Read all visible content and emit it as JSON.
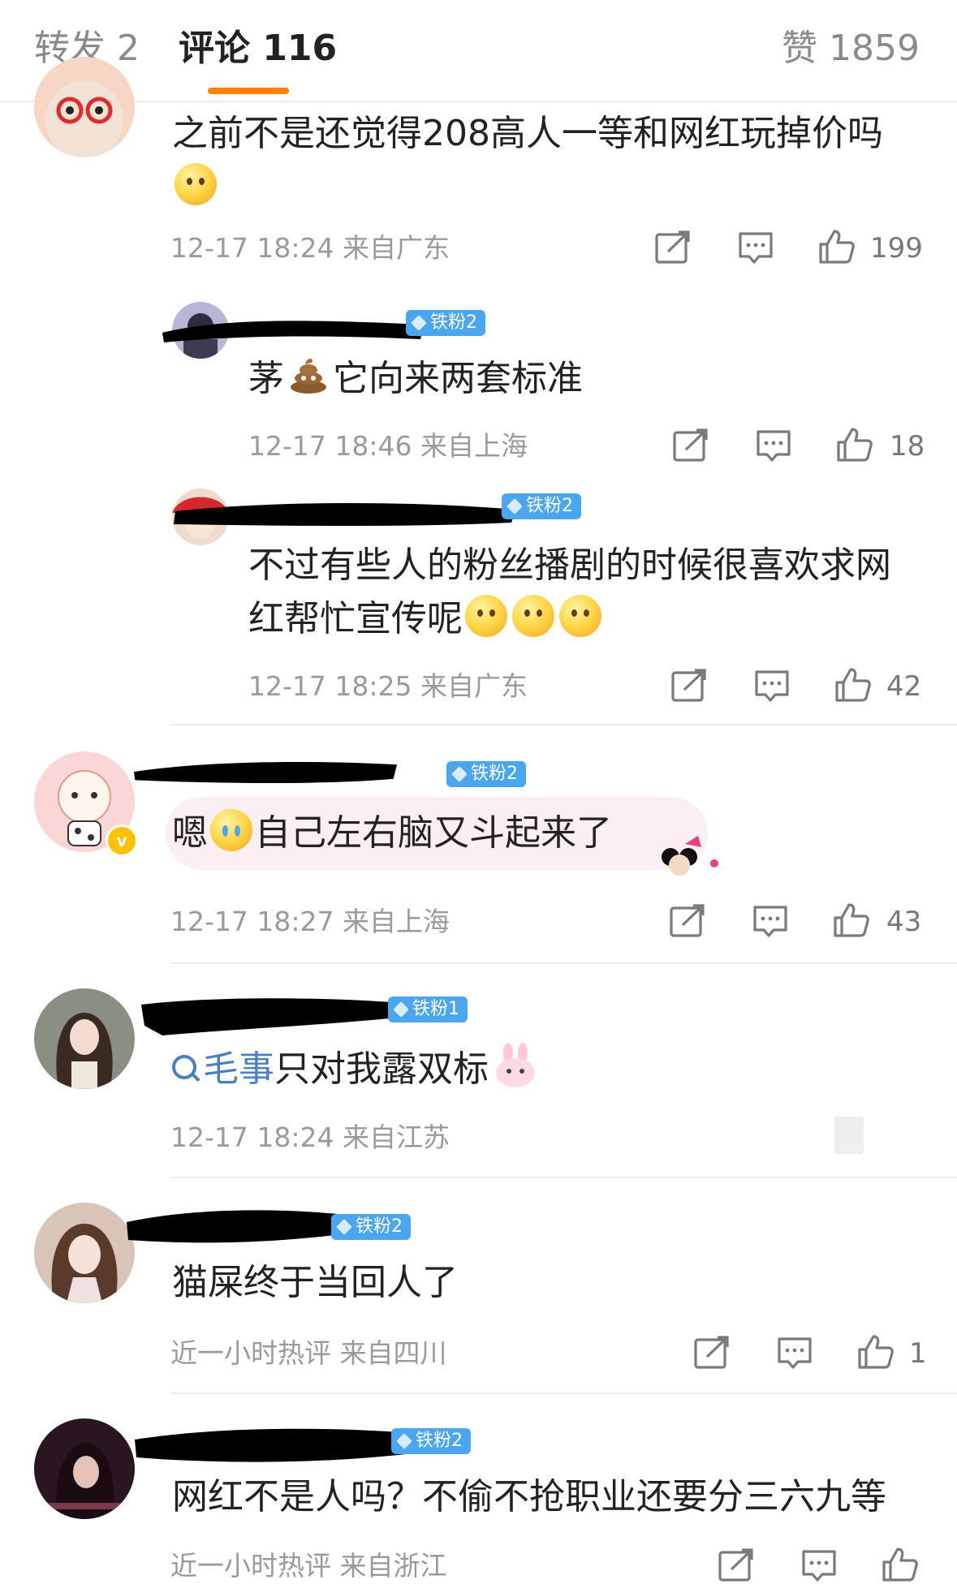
{
  "tabs": {
    "repost": "转发 2",
    "comment": "评论 116",
    "like": "赞 1859"
  },
  "comments": [
    {
      "text": "之前不是还觉得208高人一等和网红玩掉价吗",
      "time": "12-17 18:24",
      "location": "来自广东",
      "likes": "199",
      "replies": [
        {
          "badge": "铁粉2",
          "text_before": "茅",
          "text_after": "它向来两套标准",
          "time": "12-17 18:46",
          "location": "来自上海",
          "likes": "18"
        },
        {
          "badge": "铁粉2",
          "text_line1": "不过有些人的粉丝播剧的时候很喜欢求网",
          "text_line2": "红帮忙宣传呢",
          "time": "12-17 18:25",
          "location": "来自广东",
          "likes": "42"
        }
      ]
    },
    {
      "badge": "铁粉2",
      "text_prefix": "嗯",
      "text": "自己左右脑又斗起来了",
      "time": "12-17 18:27",
      "location": "来自上海",
      "likes": "43"
    },
    {
      "badge": "铁粉1",
      "topic": "毛事",
      "text": "只对我露双标",
      "time": "12-17 18:24",
      "location": "来自江苏"
    },
    {
      "badge": "铁粉2",
      "text": "猫屎终于当回人了",
      "time": "近一小时热评",
      "location": "来自四川",
      "likes": "1"
    },
    {
      "badge": "铁粉2",
      "text": "网红不是人吗？不偷不抢职业还要分三六九等",
      "time": "近一小时热评",
      "location": "来自浙江"
    }
  ],
  "colors": {
    "accent": "#ff8200",
    "badge": "#4aa6ef",
    "topic": "#4a7fc1",
    "meta": "#9a9a9a"
  },
  "icons": [
    "repost-icon",
    "comment-icon",
    "like-icon",
    "search-icon"
  ]
}
